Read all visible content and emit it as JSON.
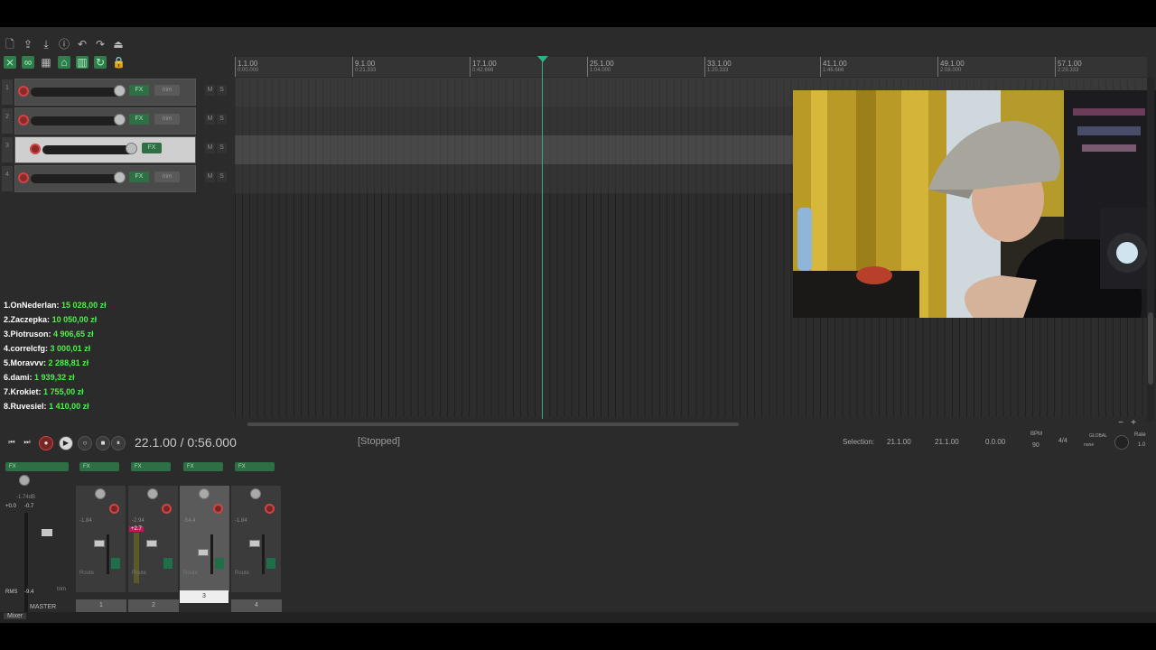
{
  "tracks": [
    {
      "number": "1",
      "fx_label": "FX",
      "trim_label": "trim"
    },
    {
      "number": "2",
      "fx_label": "FX",
      "trim_label": "trim"
    },
    {
      "number": "3",
      "fx_label": "FX",
      "trim_label": ""
    },
    {
      "number": "4",
      "fx_label": "FX",
      "trim_label": "trim"
    }
  ],
  "mute_label": "M",
  "solo_label": "S",
  "ruler": [
    {
      "bar": "1.1.00",
      "time": "0:00.000"
    },
    {
      "bar": "9.1.00",
      "time": "0:21.333"
    },
    {
      "bar": "17.1.00",
      "time": "0:42.666"
    },
    {
      "bar": "25.1.00",
      "time": "1:04.000"
    },
    {
      "bar": "33.1.00",
      "time": "1:25.333"
    },
    {
      "bar": "41.1.00",
      "time": "1:46.666"
    },
    {
      "bar": "49.1.00",
      "time": "2:08.000"
    },
    {
      "bar": "57.1.00",
      "time": "2:29.333"
    }
  ],
  "donations": [
    {
      "rank": "1.",
      "name": "OnNederlan:",
      "amount": "15 028,00 zł"
    },
    {
      "rank": "2.",
      "name": "Zaczepka:",
      "amount": "10 050,00 zł"
    },
    {
      "rank": "3.",
      "name": "Piotruson:",
      "amount": "4 906,65 zł"
    },
    {
      "rank": "4.",
      "name": "correlcfg:",
      "amount": "3 000,01 zł"
    },
    {
      "rank": "5.",
      "name": "Moravvv:",
      "amount": "2 288,81 zł"
    },
    {
      "rank": "6.",
      "name": "dami:",
      "amount": "1 939,32 zł"
    },
    {
      "rank": "7.",
      "name": "Krokiet:",
      "amount": "1 755,00 zł"
    },
    {
      "rank": "8.",
      "name": "Ruvesiel:",
      "amount": "1 410,00 zł"
    }
  ],
  "transport": {
    "position": "22.1.00 / 0:56.000",
    "status": "[Stopped]",
    "selection_label": "Selection:",
    "selection_start": "21.1.00",
    "selection_end": "21.1.00",
    "selection_length": "0.0.00",
    "bpm_label": "BPM",
    "bpm": "90",
    "time_signature": "4/4",
    "global_label": "GLOBAL",
    "none_label": "none",
    "rate_label": "Rate",
    "rate": "1.0"
  },
  "master": {
    "label": "MASTER",
    "fx_label": "FX",
    "vol_db": "-1.74dB",
    "peak_left": "+0.0",
    "peak_right": "-0.7",
    "rms_label": "RMS",
    "rms_value": "-9.4",
    "trim_label": "trim"
  },
  "mixer_strips": [
    {
      "number": "1",
      "fx_label": "FX",
      "db": "-1.84",
      "route_label": "Route"
    },
    {
      "number": "2",
      "fx_label": "FX",
      "db": "-2.94",
      "clip": "+2.7",
      "route_label": "Route"
    },
    {
      "number": "3",
      "fx_label": "FX",
      "db": "-54.4",
      "route_label": "Route"
    },
    {
      "number": "4",
      "fx_label": "FX",
      "db": "-1.84",
      "route_label": "Route"
    }
  ],
  "mixer_tab_label": "Mixer",
  "colors": {
    "accent_green": "#2fb085",
    "donation_amount": "#4cf24c",
    "record_red": "#d04545"
  }
}
